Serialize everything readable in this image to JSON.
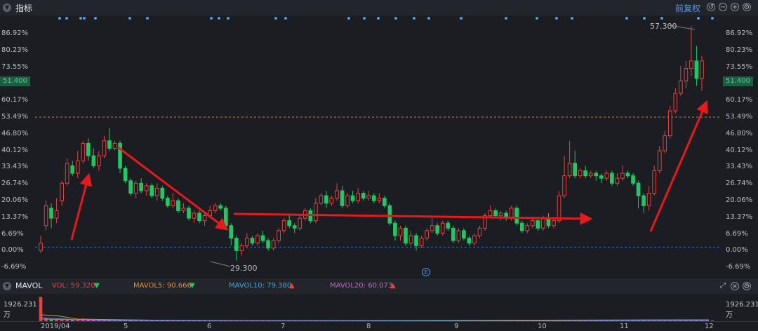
{
  "indicator_title": "指标",
  "adjust_label": "前复权",
  "toolbar_icons": [
    "undo-icon",
    "zoom-out-icon",
    "zoom-in-icon",
    "settings-icon"
  ],
  "price_axis": [
    "86.92%",
    "80.23%",
    "73.55%",
    "66.86%",
    "60.17%",
    "53.49%",
    "46.80%",
    "40.12%",
    "33.43%",
    "26.74%",
    "20.06%",
    "13.37%",
    "6.69%",
    "0.00%",
    "-6.69%"
  ],
  "current_price": "51.400",
  "high_label": "57.300",
  "low_label": "29.300",
  "event_badge": "E",
  "sub_indicator": "MAVOL",
  "vol_label": "VOL: 59.320",
  "mavol5_label": "MAVOL5: 90.666",
  "mavol10_label": "MAVOL10: 79.380",
  "mavol20_label": "MAVOL20: 60.073",
  "vol_axis_value": "1926.231",
  "vol_axis_unit": "万",
  "x_labels": [
    "2019/04",
    "5",
    "6",
    "7",
    "8",
    "9",
    "10",
    "11",
    "12"
  ],
  "colors": {
    "up": "#e8423c",
    "down": "#1ec864",
    "arrow": "#e8191d",
    "accent": "#4e9bf0",
    "mavol5": "#f08a24",
    "mavol10": "#3ea6e6",
    "mavol20": "#d25fcf"
  },
  "chart_data": {
    "type": "candlestick",
    "y_axis_percent_range": [
      -6.69,
      86.92
    ],
    "candles_pct": [
      {
        "o": 0,
        "c": 3,
        "h": 6,
        "l": -1
      },
      {
        "o": 10,
        "c": 18,
        "h": 20,
        "l": 8
      },
      {
        "o": 17,
        "c": 13,
        "h": 19,
        "l": 9
      },
      {
        "o": 13,
        "c": 16,
        "h": 21,
        "l": 11
      },
      {
        "o": 20,
        "c": 27,
        "h": 28,
        "l": 18
      },
      {
        "o": 27,
        "c": 35,
        "h": 37,
        "l": 26
      },
      {
        "o": 34,
        "c": 31,
        "h": 36,
        "l": 30
      },
      {
        "o": 31,
        "c": 36,
        "h": 40,
        "l": 29
      },
      {
        "o": 36,
        "c": 43,
        "h": 44,
        "l": 35
      },
      {
        "o": 43,
        "c": 38,
        "h": 45,
        "l": 36
      },
      {
        "o": 38,
        "c": 34,
        "h": 41,
        "l": 33
      },
      {
        "o": 34,
        "c": 38,
        "h": 40,
        "l": 32
      },
      {
        "o": 38,
        "c": 44,
        "h": 46,
        "l": 37
      },
      {
        "o": 44,
        "c": 41,
        "h": 49,
        "l": 40
      },
      {
        "o": 41,
        "c": 43,
        "h": 44,
        "l": 40
      },
      {
        "o": 43,
        "c": 33,
        "h": 44,
        "l": 31
      },
      {
        "o": 33,
        "c": 28,
        "h": 34,
        "l": 27
      },
      {
        "o": 28,
        "c": 23,
        "h": 29,
        "l": 22
      },
      {
        "o": 23,
        "c": 27,
        "h": 28,
        "l": 21
      },
      {
        "o": 27,
        "c": 24,
        "h": 29,
        "l": 23
      },
      {
        "o": 24,
        "c": 26,
        "h": 27,
        "l": 22
      },
      {
        "o": 26,
        "c": 22,
        "h": 27,
        "l": 21
      },
      {
        "o": 22,
        "c": 25,
        "h": 27,
        "l": 20
      },
      {
        "o": 25,
        "c": 21,
        "h": 26,
        "l": 20
      },
      {
        "o": 21,
        "c": 18,
        "h": 22,
        "l": 17
      },
      {
        "o": 18,
        "c": 20,
        "h": 23,
        "l": 17
      },
      {
        "o": 20,
        "c": 16,
        "h": 21,
        "l": 15
      },
      {
        "o": 16,
        "c": 17,
        "h": 19,
        "l": 15
      },
      {
        "o": 17,
        "c": 13,
        "h": 18,
        "l": 12
      },
      {
        "o": 13,
        "c": 15,
        "h": 16,
        "l": 11
      },
      {
        "o": 15,
        "c": 12,
        "h": 16,
        "l": 11
      },
      {
        "o": 12,
        "c": 14,
        "h": 15,
        "l": 10
      },
      {
        "o": 14,
        "c": 16,
        "h": 18,
        "l": 13
      },
      {
        "o": 16,
        "c": 18,
        "h": 19,
        "l": 15
      },
      {
        "o": 18,
        "c": 17,
        "h": 19,
        "l": 16
      },
      {
        "o": 17,
        "c": 10,
        "h": 18,
        "l": 9
      },
      {
        "o": 10,
        "c": 5,
        "h": 11,
        "l": 2
      },
      {
        "o": 5,
        "c": 0,
        "h": 6,
        "l": -4
      },
      {
        "o": 0,
        "c": 2,
        "h": 3,
        "l": -2
      },
      {
        "o": 2,
        "c": 5,
        "h": 7,
        "l": 1
      },
      {
        "o": 5,
        "c": 3,
        "h": 6,
        "l": 2
      },
      {
        "o": 3,
        "c": 6,
        "h": 7,
        "l": 2
      },
      {
        "o": 6,
        "c": 4,
        "h": 8,
        "l": 3
      },
      {
        "o": 4,
        "c": 1,
        "h": 5,
        "l": 0
      },
      {
        "o": 1,
        "c": 4,
        "h": 5,
        "l": 0
      },
      {
        "o": 4,
        "c": 8,
        "h": 9,
        "l": 3
      },
      {
        "o": 8,
        "c": 12,
        "h": 13,
        "l": 7
      },
      {
        "o": 12,
        "c": 10,
        "h": 14,
        "l": 9
      },
      {
        "o": 10,
        "c": 9,
        "h": 11,
        "l": 7
      },
      {
        "o": 9,
        "c": 13,
        "h": 14,
        "l": 8
      },
      {
        "o": 13,
        "c": 16,
        "h": 17,
        "l": 12
      },
      {
        "o": 16,
        "c": 12,
        "h": 17,
        "l": 11
      },
      {
        "o": 12,
        "c": 19,
        "h": 21,
        "l": 11
      },
      {
        "o": 19,
        "c": 22,
        "h": 23,
        "l": 18
      },
      {
        "o": 22,
        "c": 19,
        "h": 24,
        "l": 17
      },
      {
        "o": 19,
        "c": 21,
        "h": 22,
        "l": 18
      },
      {
        "o": 21,
        "c": 24,
        "h": 27,
        "l": 20
      },
      {
        "o": 24,
        "c": 18,
        "h": 26,
        "l": 17
      },
      {
        "o": 18,
        "c": 22,
        "h": 23,
        "l": 17
      },
      {
        "o": 22,
        "c": 20,
        "h": 24,
        "l": 19
      },
      {
        "o": 20,
        "c": 23,
        "h": 25,
        "l": 19
      },
      {
        "o": 23,
        "c": 21,
        "h": 24,
        "l": 20
      },
      {
        "o": 21,
        "c": 22,
        "h": 24,
        "l": 20
      },
      {
        "o": 22,
        "c": 20,
        "h": 23,
        "l": 19
      },
      {
        "o": 20,
        "c": 21,
        "h": 23,
        "l": 19
      },
      {
        "o": 21,
        "c": 18,
        "h": 22,
        "l": 17
      },
      {
        "o": 18,
        "c": 11,
        "h": 19,
        "l": 10
      },
      {
        "o": 11,
        "c": 6,
        "h": 12,
        "l": 4
      },
      {
        "o": 6,
        "c": 9,
        "h": 10,
        "l": 4
      },
      {
        "o": 9,
        "c": 3,
        "h": 10,
        "l": 2
      },
      {
        "o": 3,
        "c": 6,
        "h": 8,
        "l": 2
      },
      {
        "o": 6,
        "c": 2,
        "h": 7,
        "l": 0
      },
      {
        "o": 2,
        "c": 5,
        "h": 6,
        "l": 1
      },
      {
        "o": 5,
        "c": 8,
        "h": 9,
        "l": 4
      },
      {
        "o": 8,
        "c": 10,
        "h": 13,
        "l": 7
      },
      {
        "o": 10,
        "c": 7,
        "h": 11,
        "l": 6
      },
      {
        "o": 7,
        "c": 11,
        "h": 12,
        "l": 6
      },
      {
        "o": 11,
        "c": 9,
        "h": 12,
        "l": 8
      },
      {
        "o": 9,
        "c": 4,
        "h": 10,
        "l": 3
      },
      {
        "o": 4,
        "c": 8,
        "h": 9,
        "l": 3
      },
      {
        "o": 8,
        "c": 5,
        "h": 9,
        "l": 4
      },
      {
        "o": 5,
        "c": 3,
        "h": 6,
        "l": 2
      },
      {
        "o": 3,
        "c": 6,
        "h": 7,
        "l": 2
      },
      {
        "o": 6,
        "c": 9,
        "h": 10,
        "l": 5
      },
      {
        "o": 9,
        "c": 14,
        "h": 15,
        "l": 8
      },
      {
        "o": 14,
        "c": 16,
        "h": 18,
        "l": 13
      },
      {
        "o": 16,
        "c": 14,
        "h": 17,
        "l": 13
      },
      {
        "o": 14,
        "c": 15,
        "h": 16,
        "l": 12
      },
      {
        "o": 15,
        "c": 13,
        "h": 16,
        "l": 12
      },
      {
        "o": 13,
        "c": 17,
        "h": 18,
        "l": 12
      },
      {
        "o": 17,
        "c": 11,
        "h": 18,
        "l": 10
      },
      {
        "o": 11,
        "c": 8,
        "h": 12,
        "l": 7
      },
      {
        "o": 8,
        "c": 10,
        "h": 11,
        "l": 7
      },
      {
        "o": 10,
        "c": 12,
        "h": 13,
        "l": 9
      },
      {
        "o": 12,
        "c": 9,
        "h": 13,
        "l": 8
      },
      {
        "o": 9,
        "c": 13,
        "h": 14,
        "l": 8
      },
      {
        "o": 13,
        "c": 10,
        "h": 15,
        "l": 9
      },
      {
        "o": 10,
        "c": 12,
        "h": 13,
        "l": 9
      },
      {
        "o": 12,
        "c": 22,
        "h": 24,
        "l": 11
      },
      {
        "o": 22,
        "c": 30,
        "h": 38,
        "l": 21
      },
      {
        "o": 30,
        "c": 35,
        "h": 44,
        "l": 29
      },
      {
        "o": 35,
        "c": 30,
        "h": 40,
        "l": 29
      },
      {
        "o": 30,
        "c": 32,
        "h": 33,
        "l": 29
      },
      {
        "o": 32,
        "c": 30,
        "h": 34,
        "l": 29
      },
      {
        "o": 30,
        "c": 31,
        "h": 32,
        "l": 29
      },
      {
        "o": 31,
        "c": 30,
        "h": 32,
        "l": 28
      },
      {
        "o": 30,
        "c": 29,
        "h": 31,
        "l": 27
      },
      {
        "o": 29,
        "c": 31,
        "h": 32,
        "l": 28
      },
      {
        "o": 31,
        "c": 27,
        "h": 32,
        "l": 26
      },
      {
        "o": 27,
        "c": 29,
        "h": 31,
        "l": 26
      },
      {
        "o": 29,
        "c": 31,
        "h": 34,
        "l": 28
      },
      {
        "o": 31,
        "c": 30,
        "h": 32,
        "l": 29
      },
      {
        "o": 30,
        "c": 27,
        "h": 31,
        "l": 26
      },
      {
        "o": 27,
        "c": 22,
        "h": 28,
        "l": 17
      },
      {
        "o": 22,
        "c": 18,
        "h": 23,
        "l": 15
      },
      {
        "o": 18,
        "c": 23,
        "h": 26,
        "l": 16
      },
      {
        "o": 23,
        "c": 32,
        "h": 34,
        "l": 22
      },
      {
        "o": 32,
        "c": 40,
        "h": 42,
        "l": 31
      },
      {
        "o": 40,
        "c": 46,
        "h": 48,
        "l": 39
      },
      {
        "o": 46,
        "c": 56,
        "h": 58,
        "l": 45
      },
      {
        "o": 56,
        "c": 63,
        "h": 65,
        "l": 55
      },
      {
        "o": 63,
        "c": 68,
        "h": 74,
        "l": 62
      },
      {
        "o": 68,
        "c": 73,
        "h": 76,
        "l": 65
      },
      {
        "o": 73,
        "c": 76,
        "h": 90,
        "l": 70
      },
      {
        "o": 76,
        "c": 69,
        "h": 82,
        "l": 66
      },
      {
        "o": 69,
        "c": 76,
        "h": 78,
        "l": 64
      }
    ],
    "volume": [
      96,
      12,
      8,
      8,
      7,
      6,
      5,
      4,
      10,
      5,
      5,
      6,
      7,
      4,
      4,
      4,
      4,
      3,
      4,
      3,
      4,
      3,
      3,
      3,
      3,
      3,
      3,
      3,
      4,
      3,
      3,
      3,
      3,
      3,
      2,
      3,
      3,
      3,
      2,
      2,
      2,
      2,
      2,
      2,
      3,
      2,
      2,
      3,
      3,
      3,
      3,
      3,
      3,
      3,
      3,
      3,
      3,
      3,
      3,
      3,
      3,
      3,
      3,
      3,
      3,
      3,
      2,
      2,
      2,
      2,
      2,
      2,
      2,
      2,
      2,
      2,
      2,
      2,
      2,
      2,
      2,
      2,
      2,
      2,
      2,
      2,
      2,
      2,
      2,
      2,
      2,
      2,
      2,
      2,
      2,
      2,
      3,
      3,
      3,
      2,
      2,
      2,
      2,
      2,
      2,
      2,
      2,
      2,
      2,
      2,
      2,
      2,
      3,
      3,
      2,
      2,
      3,
      3,
      3,
      3,
      3,
      4,
      3,
      4,
      3,
      3,
      3,
      3
    ]
  }
}
